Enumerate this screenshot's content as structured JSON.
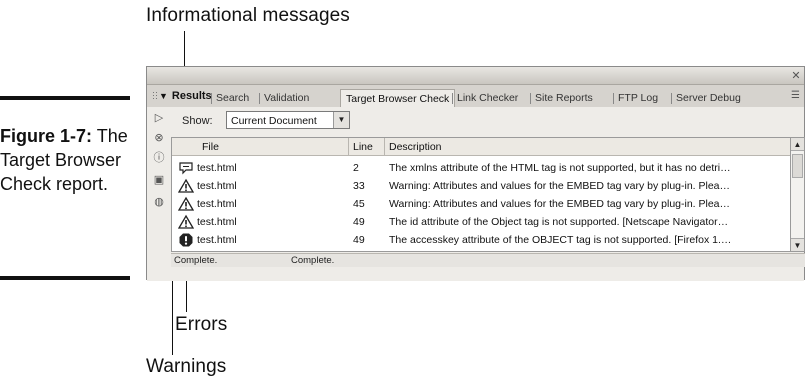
{
  "callouts": {
    "informational": "Informational messages",
    "errors": "Errors",
    "warnings": "Warnings"
  },
  "figure": {
    "number": "Figure 1-7:",
    "caption": "The Target Browser Check report."
  },
  "panel": {
    "title": "Results",
    "close_icon": "close-icon",
    "tabs": [
      "Search",
      "Validation",
      "Target Browser Check",
      "Link Checker",
      "Site Reports",
      "FTP Log",
      "Server Debug"
    ],
    "active_tab": "Target Browser Check",
    "show_label": "Show:",
    "show_value": "Current Document",
    "columns": {
      "file": "File",
      "line": "Line",
      "description": "Description"
    },
    "rows": [
      {
        "type": "info",
        "icon": "info-speech-bubble-icon",
        "file": "test.html",
        "line": "2",
        "description": "The xmlns attribute of the HTML tag is not supported, but it has no detri…"
      },
      {
        "type": "warning",
        "icon": "warning-icon",
        "file": "test.html",
        "line": "33",
        "description": "Warning: Attributes and values for the EMBED tag vary by plug-in.  Plea…"
      },
      {
        "type": "warning",
        "icon": "warning-icon",
        "file": "test.html",
        "line": "45",
        "description": "Warning: Attributes and values for the EMBED tag vary by plug-in.  Plea…"
      },
      {
        "type": "warning",
        "icon": "warning-icon",
        "file": "test.html",
        "line": "49",
        "description": "The id attribute of the Object tag is not supported. [Netscape Navigator…"
      },
      {
        "type": "error",
        "icon": "error-icon",
        "file": "test.html",
        "line": "49",
        "description": "The accesskey attribute of the OBJECT tag is not supported. [Firefox 1.…"
      }
    ],
    "status": [
      "Complete.",
      "Complete."
    ]
  }
}
